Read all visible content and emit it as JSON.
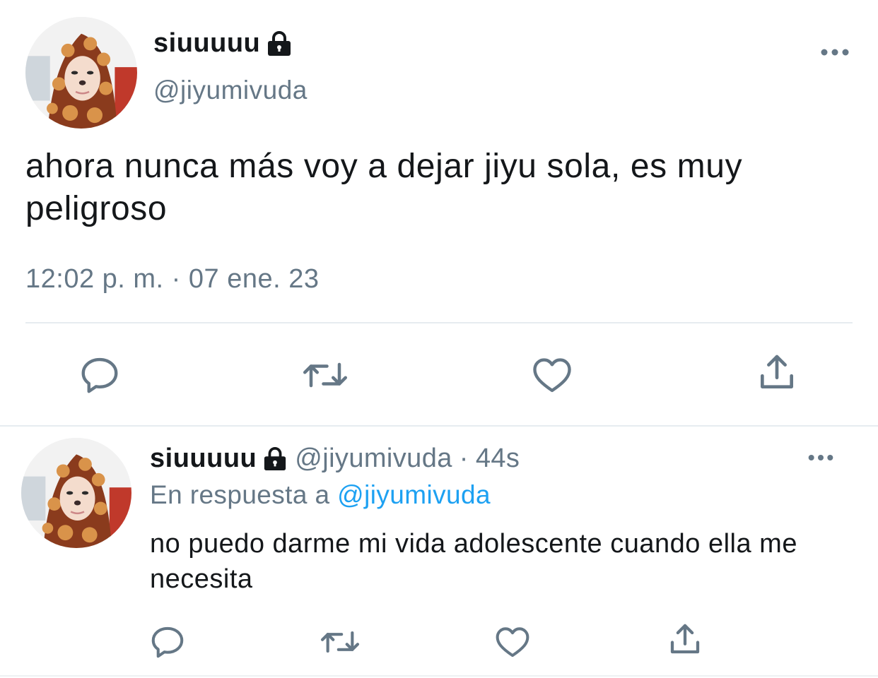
{
  "main_tweet": {
    "display_name": "siuuuuu",
    "protected_icon": "lock-icon",
    "handle": "@jiyumivuda",
    "text": "ahora nunca más voy a dejar jiyu sola, es muy peligroso",
    "timestamp": "12:02 p. m. · 07 ene. 23",
    "actions": [
      "reply-icon",
      "retweet-icon",
      "like-icon",
      "share-icon"
    ]
  },
  "reply_tweet": {
    "display_name": "siuuuuu",
    "protected_icon": "lock-icon",
    "handle": "@jiyumivuda",
    "separator": "·",
    "time_ago": "44s",
    "in_reply_prefix": "En respuesta a",
    "in_reply_handle": "@jiyumivuda",
    "text": "no puedo darme mi vida adolescente cuando ella me necesita",
    "actions": [
      "reply-icon",
      "retweet-icon",
      "like-icon",
      "share-icon"
    ]
  },
  "colors": {
    "text_primary": "#14171a",
    "text_secondary": "#657786",
    "link": "#1da1f2",
    "icon": "#657786",
    "divider": "#e6ecf0"
  }
}
